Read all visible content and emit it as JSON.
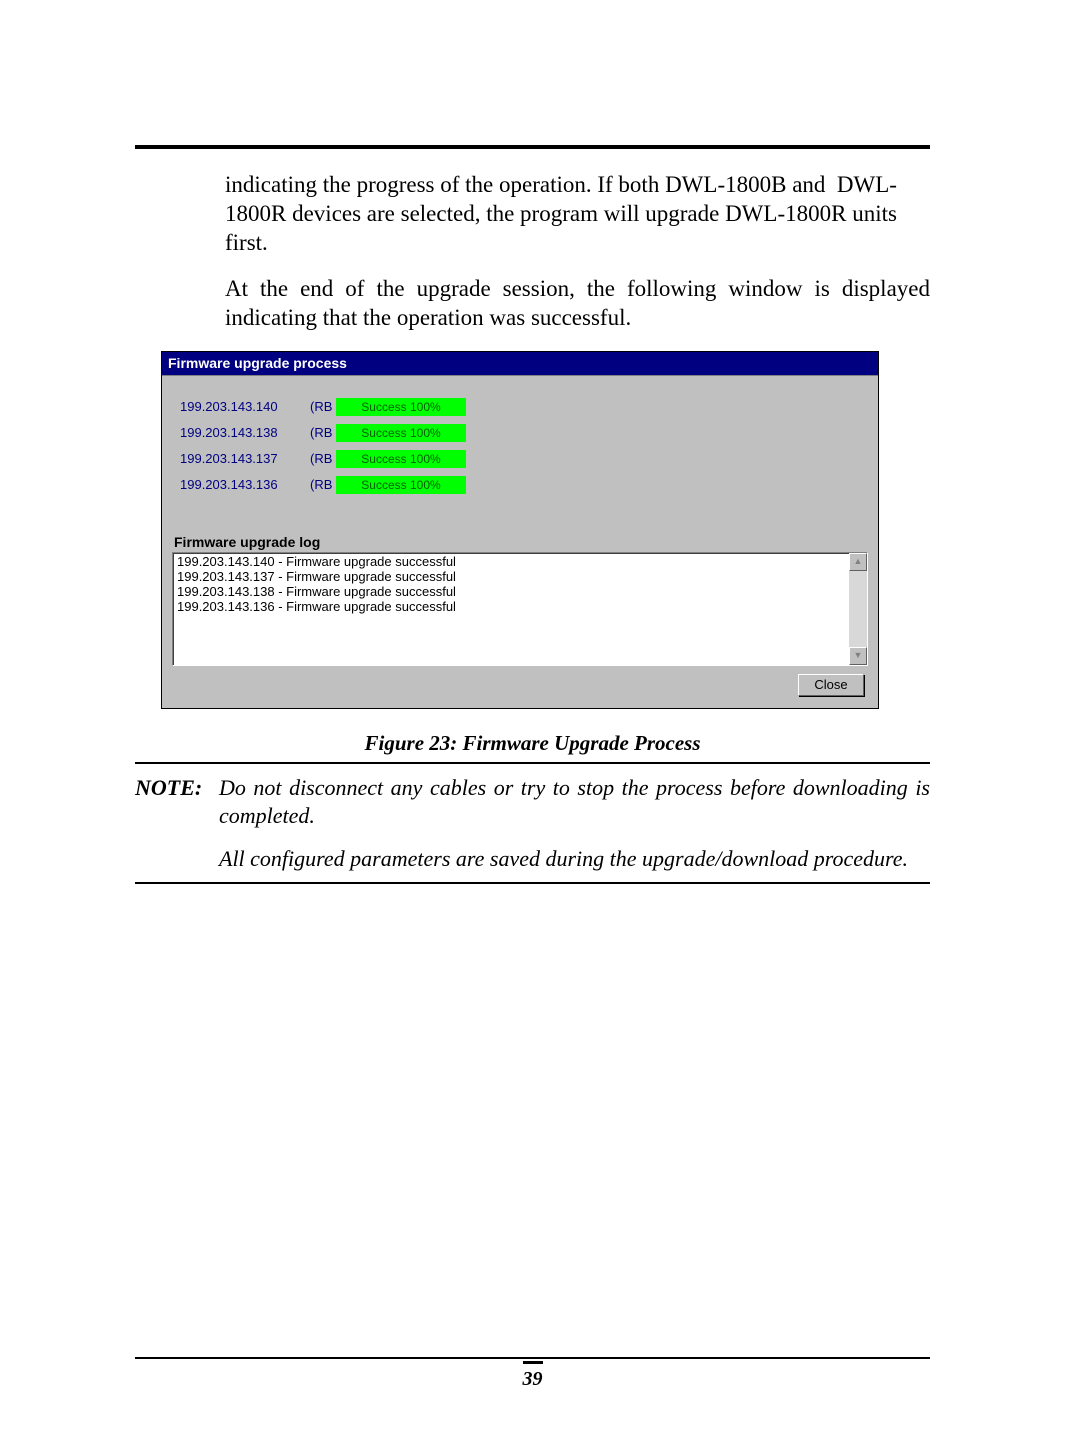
{
  "paragraph1": "indicating the progress of the operation. If both DWL-1800B and  DWL-1800R devices are selected, the program will upgrade DWL-1800R units first.",
  "paragraph2": "At the end of the upgrade session, the following window is displayed indicating that the operation was successful.",
  "window": {
    "title": "Firmware upgrade process",
    "rows": [
      {
        "ip": "199.203.143.140",
        "code": "(RB",
        "status": "Success 100%"
      },
      {
        "ip": "199.203.143.138",
        "code": "(RB",
        "status": "Success 100%"
      },
      {
        "ip": "199.203.143.137",
        "code": "(RB",
        "status": "Success 100%"
      },
      {
        "ip": "199.203.143.136",
        "code": "(RB",
        "status": "Success 100%"
      }
    ],
    "log_label": "Firmware upgrade log",
    "log": [
      "199.203.143.140 - Firmware upgrade successful",
      "199.203.143.137 - Firmware upgrade successful",
      "199.203.143.138 - Firmware upgrade successful",
      "199.203.143.136 - Firmware upgrade successful"
    ],
    "close_label": "Close"
  },
  "caption": "Figure 23: Firmware Upgrade Process",
  "note": {
    "label": "NOTE:",
    "body1": "Do not disconnect any cables or try to stop the process before downloading is completed.",
    "body2": "All configured parameters are saved during the upgrade/download procedure."
  },
  "page_number": "39"
}
